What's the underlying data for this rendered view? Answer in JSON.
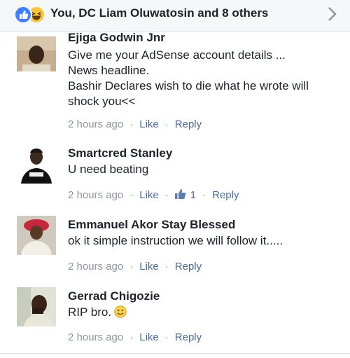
{
  "reactions": {
    "summary": "You, DC Liam Oluwatosin and 8 others",
    "icons": [
      "like-icon",
      "haha-icon"
    ]
  },
  "comments": [
    {
      "author": "Ejiga Godwin Jnr",
      "lines": [
        "Give me your AdSense account details ...",
        "News headline.",
        "Bashir Declares wish to die what he wrote will shock you<<"
      ],
      "time": "2 hours ago",
      "like": "Like",
      "reply": "Reply"
    },
    {
      "author": "Smartcred Stanley",
      "lines": [
        "U need beating"
      ],
      "time": "2 hours ago",
      "like": "Like",
      "like_count": "1",
      "reply": "Reply"
    },
    {
      "author": "Emmanuel Akor Stay Blessed",
      "lines": [
        "ok it simple instruction we will follow it....."
      ],
      "time": "2 hours ago",
      "like": "Like",
      "reply": "Reply"
    },
    {
      "author": "Gerrad Chigozie",
      "lines": [
        "RIP bro."
      ],
      "emoji": "smiley-icon",
      "time": "2 hours ago",
      "like": "Like",
      "reply": "Reply"
    }
  ],
  "separator": "·",
  "colors": {
    "link": "#4b6b94",
    "meta": "#90949c",
    "like_blue": "#4080ff",
    "bar_bg": "#f6f7f9"
  }
}
